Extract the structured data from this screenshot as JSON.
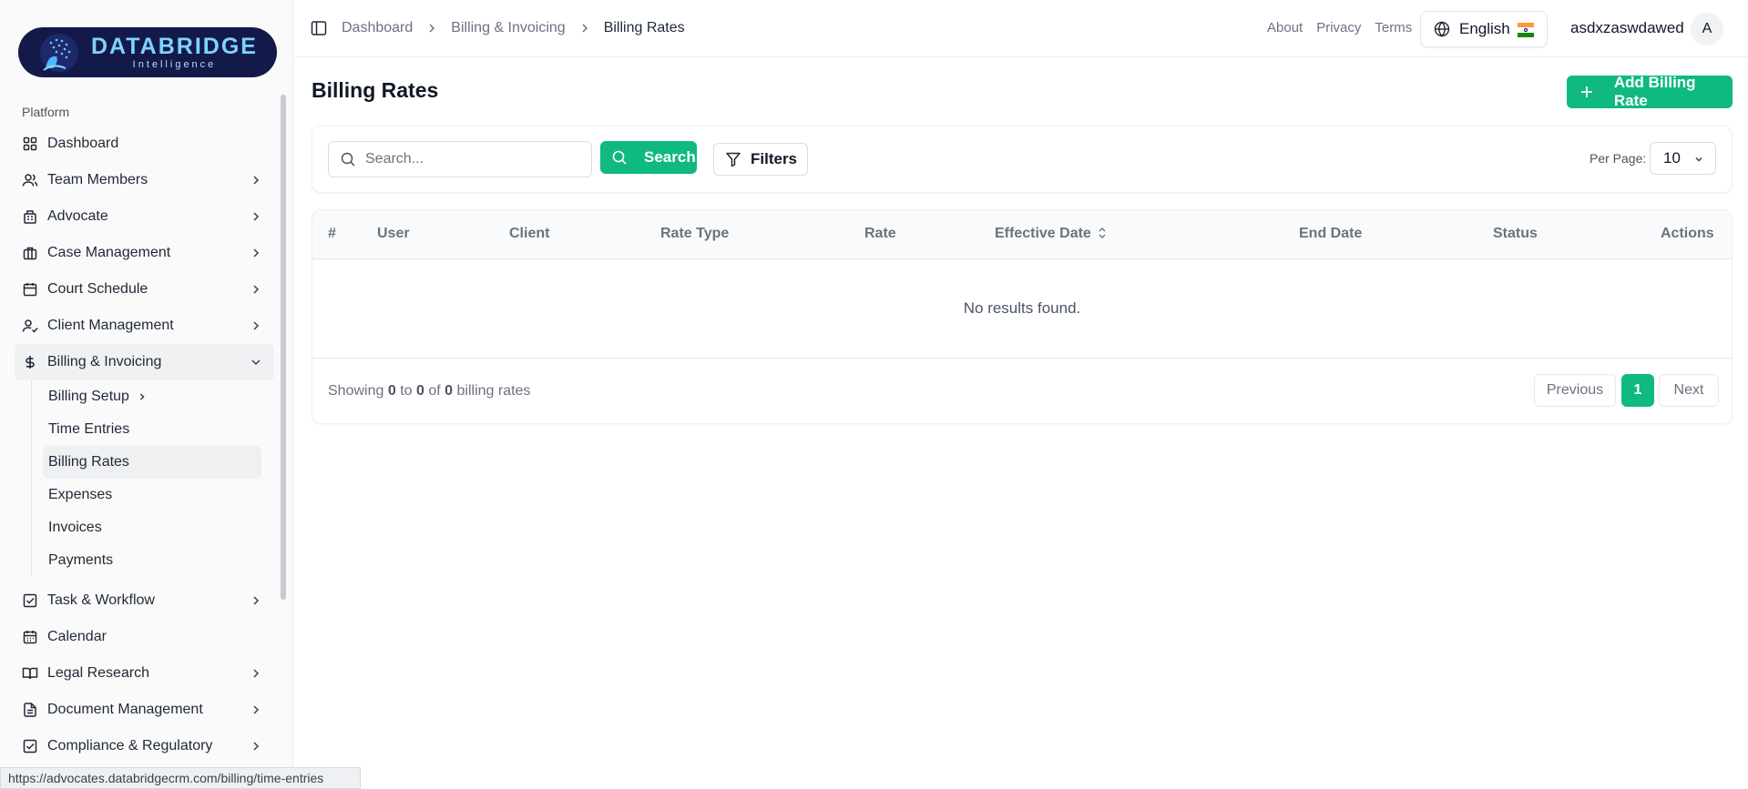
{
  "brand": {
    "title": "DATABRIDGE",
    "subtitle": "Intelligence"
  },
  "sidebar": {
    "section": "Platform",
    "items": [
      {
        "label": "Dashboard",
        "icon": "grid-icon"
      },
      {
        "label": "Team Members",
        "icon": "users-icon"
      },
      {
        "label": "Advocate",
        "icon": "building-icon"
      },
      {
        "label": "Case Management",
        "icon": "briefcase-icon"
      },
      {
        "label": "Court Schedule",
        "icon": "calendar-icon"
      },
      {
        "label": "Client Management",
        "icon": "user-check-icon"
      },
      {
        "label": "Billing & Invoicing",
        "icon": "dollar-icon"
      }
    ],
    "billing_sub": [
      {
        "label": "Billing Setup"
      },
      {
        "label": "Time Entries"
      },
      {
        "label": "Billing Rates"
      },
      {
        "label": "Expenses"
      },
      {
        "label": "Invoices"
      },
      {
        "label": "Payments"
      }
    ],
    "items_after": [
      {
        "label": "Task & Workflow",
        "icon": "checkbox-icon"
      },
      {
        "label": "Calendar",
        "icon": "calendar-icon"
      },
      {
        "label": "Legal Research",
        "icon": "book-icon"
      },
      {
        "label": "Document Management",
        "icon": "document-icon"
      },
      {
        "label": "Compliance & Regulatory",
        "icon": "checkbox-icon"
      }
    ]
  },
  "status_url": "https://advocates.databridgecrm.com/billing/time-entries",
  "header": {
    "breadcrumbs": [
      "Dashboard",
      "Billing & Invoicing",
      "Billing Rates"
    ],
    "links": [
      "About",
      "Privacy",
      "Terms"
    ],
    "language": "English",
    "username": "asdxzaswdawed",
    "avatar_initial": "A"
  },
  "main": {
    "title": "Billing Rates",
    "add_button": "Add Billing Rate",
    "search_placeholder": "Search...",
    "search_button": "Search",
    "filters_button": "Filters",
    "per_page_label": "Per Page:",
    "per_page_value": "10",
    "columns": [
      "#",
      "User",
      "Client",
      "Rate Type",
      "Rate",
      "Effective Date",
      "End Date",
      "Status",
      "Actions"
    ],
    "empty_message": "No results found.",
    "showing": {
      "prefix": "Showing",
      "from": "0",
      "to_word": "to",
      "to": "0",
      "of_word": "of",
      "total": "0",
      "suffix": "billing rates"
    },
    "pagination": {
      "previous": "Previous",
      "current": "1",
      "next": "Next"
    }
  },
  "colors": {
    "accent": "#10b981",
    "brand_bg": "#131a4a",
    "brand_text": "#7fd3ff"
  }
}
